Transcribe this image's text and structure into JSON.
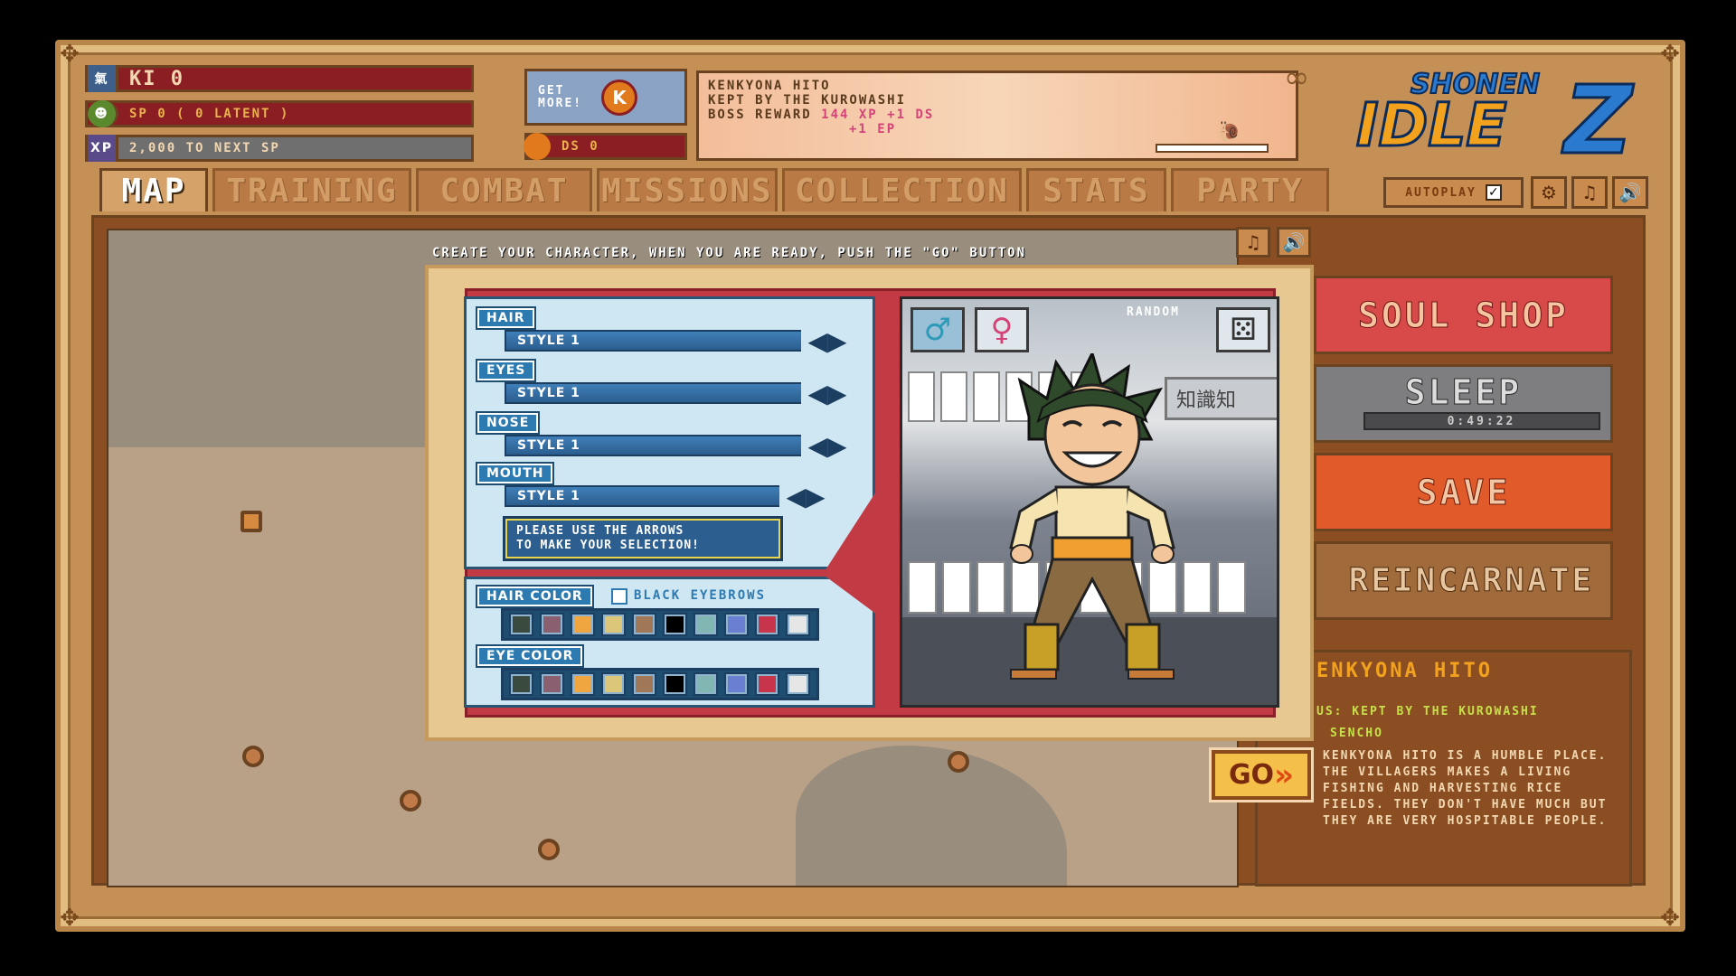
{
  "hud": {
    "ki_label": "KI 0",
    "sp_label": "SP 0 ( 0 LATENT )",
    "xp_label": "2,000 TO NEXT SP",
    "ki_icon": "ki-icon",
    "sp_icon": "sp-icon",
    "xp_icon_text": "XP",
    "get_more_label": "GET MORE!",
    "ds_label": "DS 0",
    "boss_line1": "KENKYONA HITO",
    "boss_line2": "KEPT BY THE KUROWASHI",
    "boss_reward_prefix": "BOSS REWARD",
    "boss_reward_value": "144 XP +1 DS",
    "boss_reward_ep": "+1 EP",
    "logo_top": "SHONEN",
    "logo_main": "IDLE",
    "logo_z": "Z"
  },
  "tabs": [
    "MAP",
    "TRAINING",
    "COMBAT",
    "MISSIONS",
    "COLLECTION",
    "STATS",
    "PARTY"
  ],
  "active_tab": "MAP",
  "toolbar": {
    "autoplay_label": "AUTOPLAY",
    "autoplay_check": "✓"
  },
  "modal": {
    "instruction": "CREATE YOUR CHARACTER, WHEN YOU ARE READY, PUSH THE \"GO\" BUTTON",
    "features": [
      {
        "label": "HAIR",
        "value": "STYLE 1"
      },
      {
        "label": "EYES",
        "value": "STYLE 1"
      },
      {
        "label": "NOSE",
        "value": "STYLE 1"
      },
      {
        "label": "MOUTH",
        "value": "STYLE 1"
      }
    ],
    "hint_line1": "PLEASE USE THE ARROWS",
    "hint_line2": "TO MAKE YOUR SELECTION!",
    "hair_color_label": "HAIR COLOR",
    "black_eyebrows_label": "BLACK EYEBROWS",
    "eye_color_label": "EYE COLOR",
    "random_label": "RANDOM",
    "go_label": "GO",
    "colors": [
      "#3a4a3e",
      "#8a6070",
      "#f0a640",
      "#dcc67a",
      "#a07858",
      "#000000",
      "#82b6b2",
      "#6a7ed2",
      "#c8344a",
      "#e6e6e6"
    ]
  },
  "side": {
    "soul_shop": "SOUL SHOP",
    "sleep": "SLEEP",
    "sleep_timer": "0:49:22",
    "save": "SAVE",
    "reincarnate": "REINCARNATE"
  },
  "info": {
    "title": "ENKYONA HITO",
    "status": "US: KEPT BY THE KUROWASHI",
    "sub": "SENCHO",
    "desc": "KENKYONA HITO IS A HUMBLE PLACE. THE VILLAGERS MAKES A LIVING FISHING AND HARVESTING RICE FIELDS. THEY DON'T HAVE MUCH BUT THEY ARE VERY HOSPITABLE PEOPLE."
  },
  "preview": {
    "sign_text": "知識知"
  }
}
